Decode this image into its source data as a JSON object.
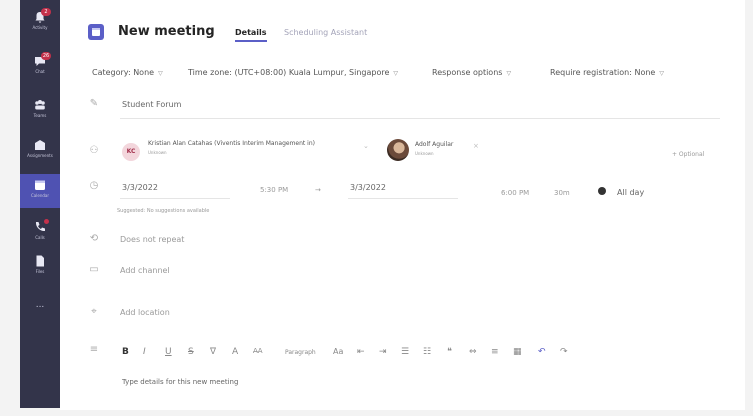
{
  "rail": {
    "items": [
      {
        "label": "Activity",
        "icon": "bell-icon",
        "badge": "2"
      },
      {
        "label": "Chat",
        "icon": "chat-icon",
        "badge": "26"
      },
      {
        "label": "Teams",
        "icon": "teams-icon"
      },
      {
        "label": "Assignments",
        "icon": "assignments-icon"
      },
      {
        "label": "Calendar",
        "icon": "calendar-icon"
      },
      {
        "label": "Calls",
        "icon": "phone-icon"
      },
      {
        "label": "Files",
        "icon": "file-icon"
      },
      {
        "label": "...",
        "icon": "more-icon"
      }
    ]
  },
  "header": {
    "title": "New meeting",
    "tab_details": "Details",
    "tab_scheduling": "Scheduling Assistant"
  },
  "options": {
    "category": "Category: None",
    "timezone": "Time zone: (UTC+08:00) Kuala Lumpur, Singapore",
    "response": "Response options",
    "registration": "Require registration: None"
  },
  "meeting": {
    "title_value": "Student Forum",
    "attendees": [
      {
        "initials": "KC",
        "name": "Kristian Alan Catahas (Viventis Interim Management in)",
        "status": "Unknown"
      },
      {
        "name": "Adolf Aguilar",
        "status": "Unknown"
      }
    ],
    "optional": "+ Optional",
    "start_date": "3/3/2022",
    "start_time": "5:30 PM",
    "arrow": "→",
    "end_date": "3/3/2022",
    "end_time": "6:00 PM",
    "duration": "30m",
    "all_day": "All day",
    "suggested": "Suggested: No suggestions available",
    "repeat": "Does not repeat",
    "channel_placeholder": "Add channel",
    "location_placeholder": "Add location",
    "details_placeholder": "Type details for this new meeting",
    "paragraph": "Paragraph"
  },
  "toolbar": [
    "B",
    "I",
    "U",
    "S",
    "∇",
    "A",
    "A̶A",
    "Aa",
    "⇤",
    "⇥",
    "☰",
    "☷",
    "❝",
    "⇔",
    "≡",
    "▦",
    "↶",
    "↷"
  ]
}
